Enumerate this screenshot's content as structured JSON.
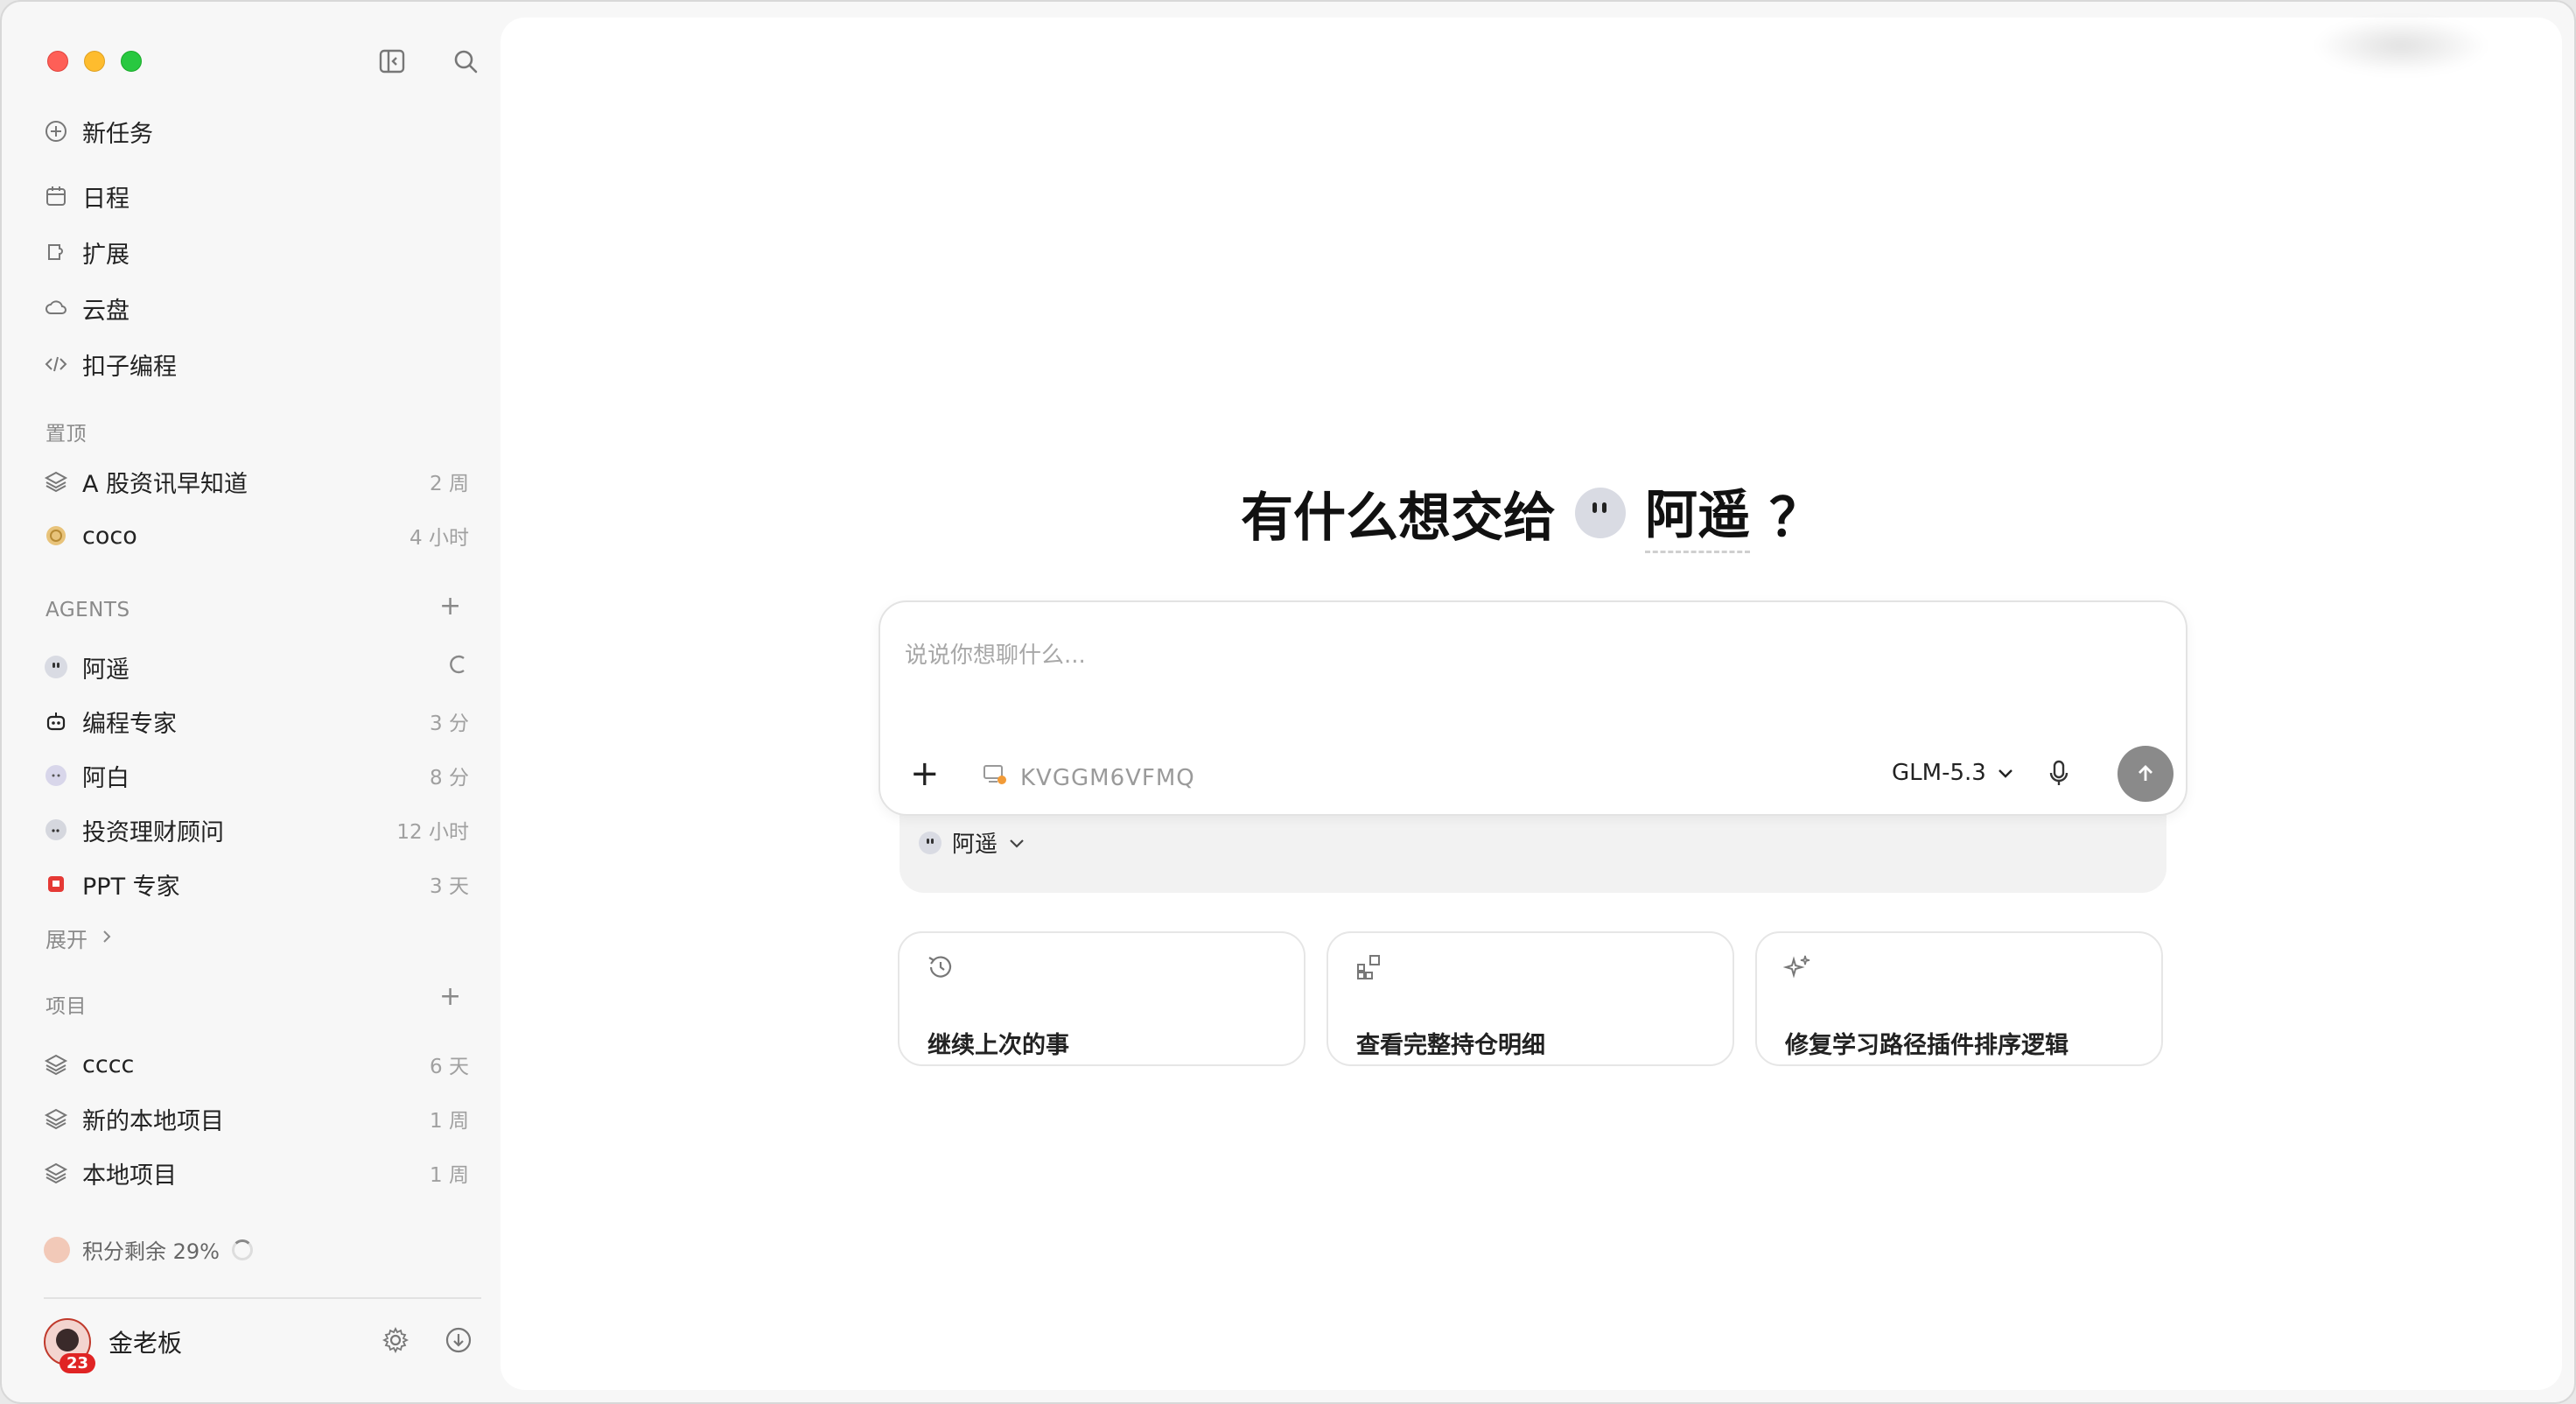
{
  "sidebar": {
    "nav": [
      {
        "label": "新任务",
        "icon": "plus-circle-icon"
      },
      {
        "label": "日程",
        "icon": "calendar-icon"
      },
      {
        "label": "扩展",
        "icon": "extension-icon"
      },
      {
        "label": "云盘",
        "icon": "cloud-icon"
      },
      {
        "label": "扣子编程",
        "icon": "code-icon"
      }
    ],
    "pinned": {
      "title": "置顶",
      "items": [
        {
          "label": "A 股资讯早知道",
          "time": "2 周"
        },
        {
          "label": "coco",
          "time": "4 小时"
        }
      ]
    },
    "agents": {
      "title": "AGENTS",
      "items": [
        {
          "label": "阿遥",
          "time": ""
        },
        {
          "label": "编程专家",
          "time": "3 分"
        },
        {
          "label": "阿白",
          "time": "8 分"
        },
        {
          "label": "投资理财顾问",
          "time": "12 小时"
        },
        {
          "label": "PPT 专家",
          "time": "3 天"
        }
      ],
      "expand": "展开"
    },
    "projects": {
      "title": "项目",
      "items": [
        {
          "label": "cccc",
          "time": "6 天"
        },
        {
          "label": "新的本地项目",
          "time": "1 周"
        },
        {
          "label": "本地项目",
          "time": "1 周"
        }
      ]
    },
    "credit": "积分剩余 29%",
    "user": {
      "name": "金老板",
      "badge": "23"
    }
  },
  "main": {
    "hero": {
      "prefix": "有什么想交给",
      "agent": "阿遥",
      "suffix": "？"
    },
    "composer": {
      "placeholder": "说说你想聊什么...",
      "env": "KVGGM6VFMQ",
      "model": "GLM-5.3"
    },
    "agent_select": "阿遥",
    "cards": [
      {
        "label": "继续上次的事",
        "icon": "history-icon"
      },
      {
        "label": "查看完整持仓明细",
        "icon": "widgets-icon"
      },
      {
        "label": "修复学习路径插件排序逻辑",
        "icon": "sparkle-icon"
      }
    ]
  },
  "colors": {
    "send_button": "#8a8a8a",
    "sidebar_bg": "#f7f7f7",
    "main_bg": "#ffffff"
  }
}
